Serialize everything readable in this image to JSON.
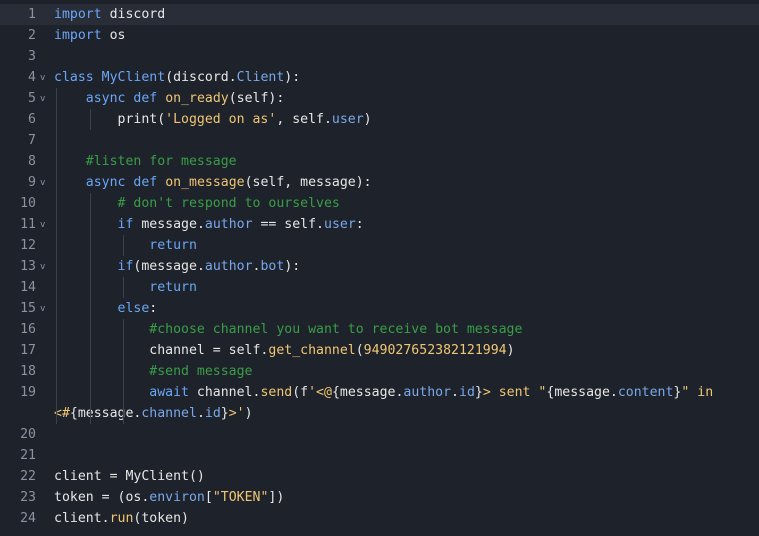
{
  "editor": {
    "lines": [
      {
        "n": "1",
        "tokens": [
          [
            "kw",
            "import"
          ],
          [
            "plain",
            " discord"
          ]
        ]
      },
      {
        "n": "2",
        "tokens": [
          [
            "kw",
            "import"
          ],
          [
            "plain",
            " os"
          ]
        ]
      },
      {
        "n": "3",
        "tokens": []
      },
      {
        "n": "4",
        "tokens": [
          [
            "kw",
            "class"
          ],
          [
            "plain",
            " "
          ],
          [
            "kw",
            "MyClient"
          ],
          [
            "plain",
            "(discord."
          ],
          [
            "attr",
            "Client"
          ],
          [
            "plain",
            "):"
          ]
        ]
      },
      {
        "n": "5",
        "tokens": [
          [
            "plain",
            "    "
          ],
          [
            "kw",
            "async def"
          ],
          [
            "plain",
            " "
          ],
          [
            "fn",
            "on_ready"
          ],
          [
            "plain",
            "(self):"
          ]
        ]
      },
      {
        "n": "6",
        "tokens": [
          [
            "plain",
            "        print("
          ],
          [
            "str",
            "'Logged on as'"
          ],
          [
            "plain",
            ", self."
          ],
          [
            "attr",
            "user"
          ],
          [
            "plain",
            ")"
          ]
        ]
      },
      {
        "n": "7",
        "tokens": []
      },
      {
        "n": "8",
        "tokens": [
          [
            "plain",
            "    "
          ],
          [
            "cmt",
            "#listen for message"
          ]
        ]
      },
      {
        "n": "9",
        "tokens": [
          [
            "plain",
            "    "
          ],
          [
            "kw",
            "async def"
          ],
          [
            "plain",
            " "
          ],
          [
            "fn",
            "on_message"
          ],
          [
            "plain",
            "(self, message):"
          ]
        ]
      },
      {
        "n": "10",
        "tokens": [
          [
            "plain",
            "        "
          ],
          [
            "cmt",
            "# don't respond to ourselves"
          ]
        ]
      },
      {
        "n": "11",
        "tokens": [
          [
            "plain",
            "        "
          ],
          [
            "kw",
            "if"
          ],
          [
            "plain",
            " message."
          ],
          [
            "attr",
            "author"
          ],
          [
            "plain",
            " == self."
          ],
          [
            "attr",
            "user"
          ],
          [
            "plain",
            ":"
          ]
        ]
      },
      {
        "n": "12",
        "tokens": [
          [
            "plain",
            "            "
          ],
          [
            "kw",
            "return"
          ]
        ]
      },
      {
        "n": "13",
        "tokens": [
          [
            "plain",
            "        "
          ],
          [
            "kw",
            "if"
          ],
          [
            "plain",
            "(message."
          ],
          [
            "attr",
            "author"
          ],
          [
            "plain",
            "."
          ],
          [
            "attr",
            "bot"
          ],
          [
            "plain",
            "):"
          ]
        ]
      },
      {
        "n": "14",
        "tokens": [
          [
            "plain",
            "            "
          ],
          [
            "kw",
            "return"
          ]
        ]
      },
      {
        "n": "15",
        "tokens": [
          [
            "plain",
            "        "
          ],
          [
            "kw",
            "else"
          ],
          [
            "plain",
            ":"
          ]
        ]
      },
      {
        "n": "16",
        "tokens": [
          [
            "plain",
            "            "
          ],
          [
            "cmt",
            "#choose channel you want to receive bot message"
          ]
        ]
      },
      {
        "n": "17",
        "tokens": [
          [
            "plain",
            "            channel = self."
          ],
          [
            "fn",
            "get_channel"
          ],
          [
            "plain",
            "("
          ],
          [
            "num",
            "949027652382121994"
          ],
          [
            "plain",
            ")"
          ]
        ]
      },
      {
        "n": "18",
        "tokens": [
          [
            "plain",
            "            "
          ],
          [
            "cmt",
            "#send message"
          ]
        ]
      },
      {
        "n": "19",
        "tokens": [
          [
            "plain",
            "            "
          ],
          [
            "kw",
            "await"
          ],
          [
            "plain",
            " channel."
          ],
          [
            "fn",
            "send"
          ],
          [
            "plain",
            "(f"
          ],
          [
            "str",
            "'<@"
          ],
          [
            "plain",
            "{message."
          ],
          [
            "attr",
            "author"
          ],
          [
            "plain",
            "."
          ],
          [
            "attr",
            "id"
          ],
          [
            "plain",
            "}"
          ],
          [
            "str",
            "> sent \""
          ],
          [
            "plain",
            "{message."
          ],
          [
            "attr",
            "content"
          ],
          [
            "plain",
            "}"
          ],
          [
            "str",
            "\" in"
          ]
        ]
      },
      {
        "n": "",
        "tokens": [
          [
            "str",
            "<#"
          ],
          [
            "plain",
            "{message."
          ],
          [
            "attr",
            "channel"
          ],
          [
            "plain",
            "."
          ],
          [
            "attr",
            "id"
          ],
          [
            "plain",
            "}"
          ],
          [
            "str",
            ">'"
          ],
          [
            "plain",
            ")"
          ]
        ]
      },
      {
        "n": "20",
        "tokens": []
      },
      {
        "n": "21",
        "tokens": []
      },
      {
        "n": "22",
        "tokens": [
          [
            "plain",
            "client = MyClient()"
          ]
        ]
      },
      {
        "n": "23",
        "tokens": [
          [
            "plain",
            "token = (os."
          ],
          [
            "attr",
            "environ"
          ],
          [
            "plain",
            "["
          ],
          [
            "str",
            "\"TOKEN\""
          ],
          [
            "plain",
            "])"
          ]
        ]
      },
      {
        "n": "24",
        "tokens": [
          [
            "plain",
            "client."
          ],
          [
            "fn",
            "run"
          ],
          [
            "plain",
            "(token)"
          ]
        ]
      }
    ],
    "fold_marker": "v",
    "fold_lines": [
      "4",
      "5",
      "9",
      "11",
      "13",
      "15"
    ],
    "active_line": "1",
    "colors": {
      "background": "#1e222a",
      "active_line": "#282d37",
      "keyword": "#6ba6f6",
      "function": "#f0c674",
      "string": "#f0c674",
      "comment": "#3a9e48",
      "attribute": "#7aa8ea",
      "text": "#e6e6e6",
      "line_number": "#8a93a3"
    }
  }
}
